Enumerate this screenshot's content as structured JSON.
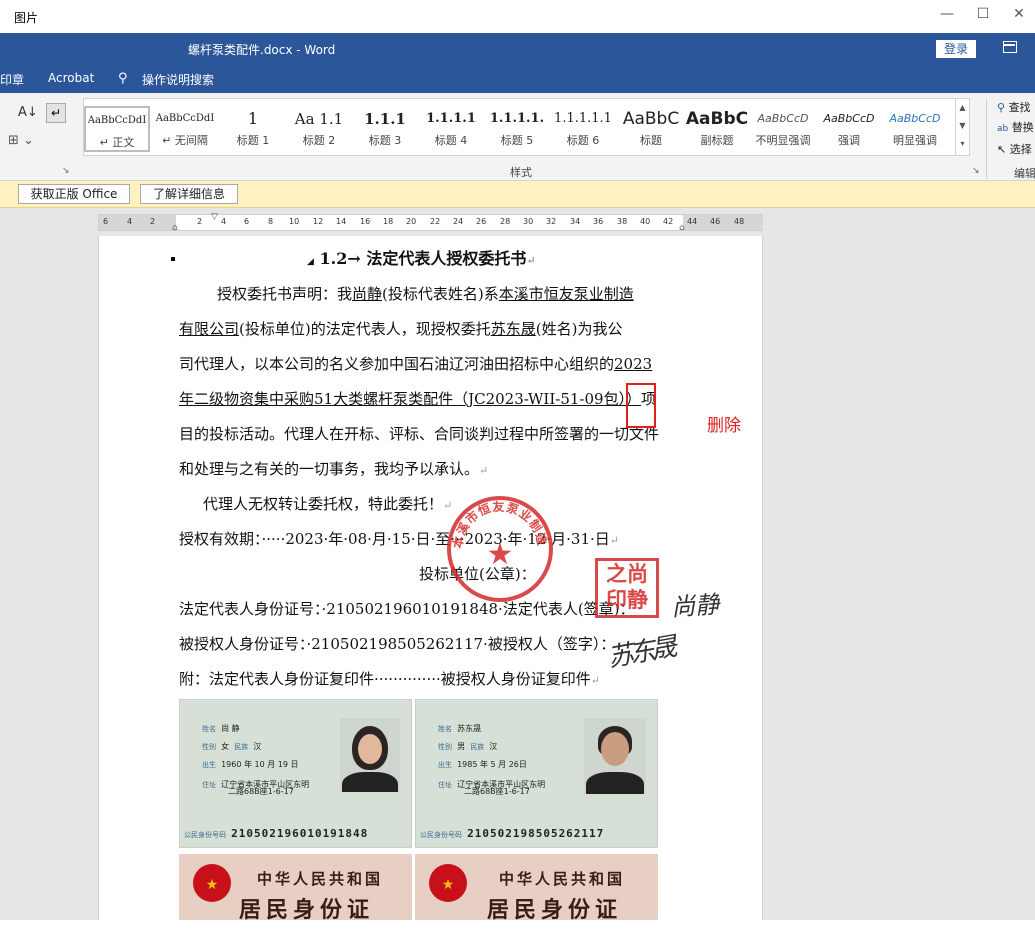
{
  "viewer": {
    "title": "图片"
  },
  "window": {
    "doc_title": "螺杆泵类配件.docx  -  Word",
    "login": "登录"
  },
  "menu": {
    "items": [
      "印章",
      "Acrobat",
      "操作说明搜索"
    ]
  },
  "ribbon": {
    "styles": [
      {
        "preview": "AaBbCcDdI",
        "name": "正文"
      },
      {
        "preview": "AaBbCcDdI",
        "name": "无间隔"
      },
      {
        "preview": "1",
        "name": "标题 1"
      },
      {
        "preview": "Aa 1.1",
        "name": "标题 2"
      },
      {
        "preview": "1.1.1",
        "name": "标题 3"
      },
      {
        "preview": "1.1.1.1",
        "name": "标题 4"
      },
      {
        "preview": "1.1.1.1.",
        "name": "标题 5"
      },
      {
        "preview": "1.1.1.1.1",
        "name": "标题 6"
      },
      {
        "preview": "AaBbC",
        "name": "标题"
      },
      {
        "preview": "AaBbC",
        "name": "副标题"
      },
      {
        "preview": "AaBbCcD",
        "name": "不明显强调"
      },
      {
        "preview": "AaBbCcD",
        "name": "强调"
      },
      {
        "preview": "AaBbCcD",
        "name": "明显强调"
      }
    ],
    "styles_group_label": "样式",
    "right_items": [
      "查找",
      "替换",
      "选择"
    ],
    "right_group_label": "编辑"
  },
  "notification": {
    "get_office": "获取正版 Office",
    "learn_more": "了解详细信息"
  },
  "ruler": {
    "ticks": [
      "6",
      "4",
      "2",
      "2",
      "4",
      "6",
      "8",
      "10",
      "12",
      "14",
      "16",
      "18",
      "20",
      "22",
      "24",
      "26",
      "28",
      "30",
      "32",
      "34",
      "36",
      "38",
      "40",
      "42",
      "44",
      "46",
      "48"
    ]
  },
  "document": {
    "heading": "1.2→ 法定代表人授权委托书",
    "p1": {
      "a": "授权委托书声明：我",
      "name1": "尚静",
      "b": "(投标代表姓名)系",
      "company1": "本溪市恒友泵业制造",
      "company2": "有限公司",
      "c": "(投标单位)的法定代表人，现授权委托",
      "name2": "苏东晟",
      "d": "(姓名)为我公",
      "e": "司代理人，以本公司的名义参加中国石油辽河油田招标中心组织的",
      "project1": "2023",
      "project2": "年二级物资集中采购51大类螺杆泵类配件（JC2023-WII-51-09包））",
      "f": "项",
      "g": "目的投标活动。代理人在开标、评标、合同谈判过程中所签署的一切文件",
      "h": "和处理与之有关的一切事务，我均予以承认。"
    },
    "p2": "代理人无权转让委托权，特此委托！",
    "validity": "授权有效期：·····2023·年·08·月·15·日·至···2023·年·12·月·31·日",
    "unit": "投标单位(公章)：",
    "legal_rep": "法定代表人身份证号：·210502196010191848·法定代表人(签章)：",
    "authorized": "被授权人身份证号：·210502198505262117·被授权人（签字）：",
    "attachment": "附：法定代表人身份证复印件··············被授权人身份证复印件",
    "pilcrow": "↵"
  },
  "annotation": {
    "text": "删除",
    "color": "#e02020"
  },
  "stamps": {
    "round": "本溪市恒友泵业制造有限公司",
    "square": [
      "之尚",
      "印静"
    ],
    "signature1": "尚静",
    "signature2": "苏东晟"
  },
  "id_cards": [
    {
      "keys": [
        "姓名",
        "性别",
        "民族",
        "出生",
        "住址"
      ],
      "name": "尚 静",
      "sex": "女",
      "ethnicity": "汉",
      "birth": "1960 年 10 月 19 日",
      "address1": "辽宁省本溪市平山区东明",
      "address2": "二路68B座1-6-17",
      "id_label": "公民身份号码",
      "id": "210502196010191848"
    },
    {
      "keys": [
        "姓名",
        "性别",
        "民族",
        "出生",
        "住址"
      ],
      "name": "苏东晟",
      "sex": "男",
      "ethnicity": "汉",
      "birth": "1985 年 5 月 26日",
      "address1": "辽宁省本溪市平山区东明",
      "address2": "二路68B座1-6-17",
      "id_label": "公民身份号码",
      "id": "210502198505262117"
    }
  ],
  "id_backs": [
    {
      "line1": "中华人民共和国",
      "line2": "居民身份证"
    },
    {
      "line1": "中华人民共和国",
      "line2": "居民身份证"
    }
  ]
}
